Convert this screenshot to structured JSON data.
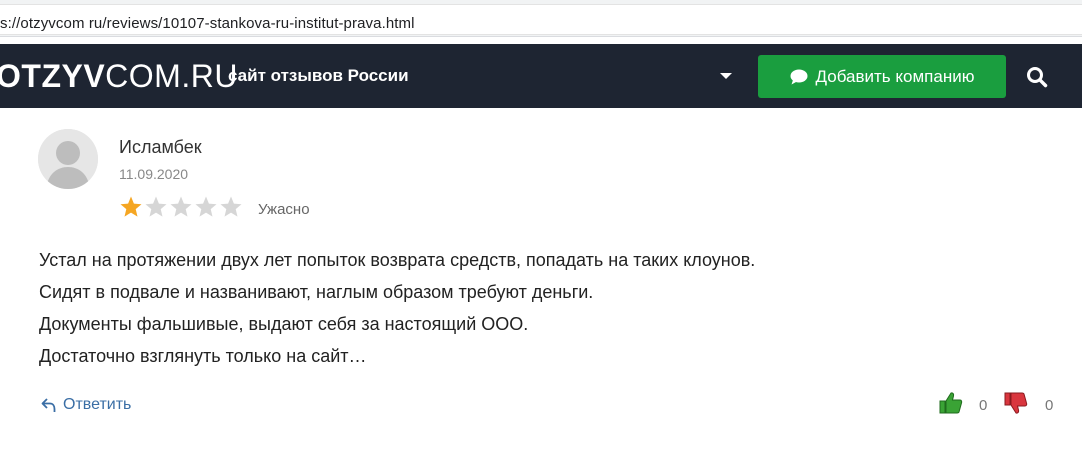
{
  "browser": {
    "url": "s://otzyvcom ru/reviews/10107-stankova-ru-institut-prava.html"
  },
  "header": {
    "logo_bold": "OTZYV",
    "logo_rest": "COM.RU",
    "tagline": "сайт отзывов России",
    "add_company_label": "Добавить компанию",
    "dropdown_icon": "caret-down-icon",
    "search_icon": "search-icon",
    "background_color": "#1e2532",
    "button_color": "#1a9e3f"
  },
  "review": {
    "author": "Исламбек",
    "date": "11.09.2020",
    "rating": 1,
    "rating_max": 5,
    "rating_label": "Ужасно",
    "star_color": "#f5a623",
    "lines": [
      "Устал на протяжении двух лет попыток возврата средств, попадать на таких клоунов.",
      "Сидят в подвале и названивают, наглым образом требуют деньги.",
      "Документы фальшивые, выдают себя за настоящий ООО.",
      "Достаточно взглянуть только на сайт…"
    ],
    "reply_label": "Ответить",
    "likes": "0",
    "dislikes": "0",
    "like_color": "#3aa335",
    "dislike_color": "#d9363e"
  }
}
